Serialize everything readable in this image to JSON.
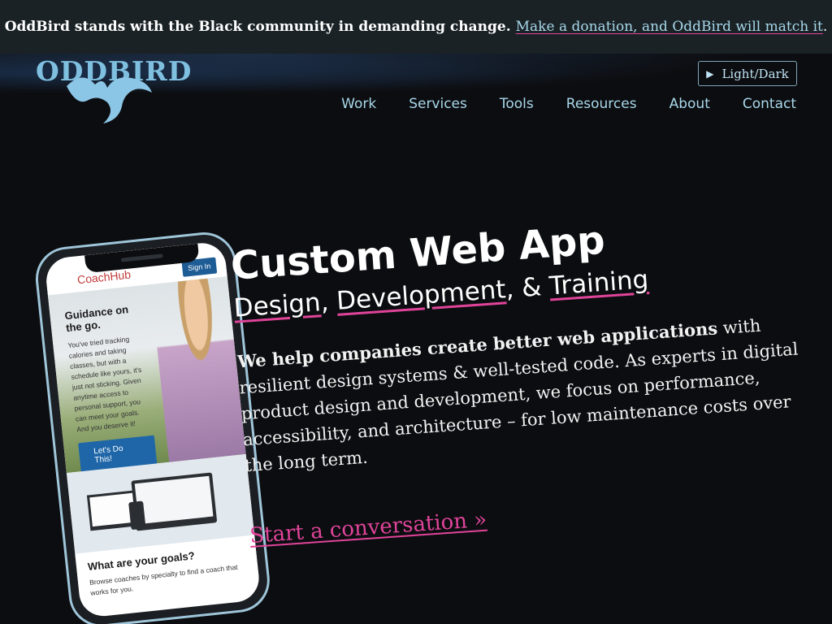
{
  "announcement": {
    "message": "OddBird stands with the Black community in demanding change.",
    "link": "Make a donation, and OddBird will match it",
    "trailing": "."
  },
  "logo": {
    "text": "ODDBIRD"
  },
  "theme_toggle": {
    "label": "Light/Dark"
  },
  "nav": {
    "items": [
      "Work",
      "Services",
      "Tools",
      "Resources",
      "About",
      "Contact"
    ]
  },
  "phone": {
    "brand": "CoachHub",
    "signin": "Sign In",
    "hero_title": "Guidance on the go.",
    "hero_body": "You've tried tracking calories and taking classes, but with a schedule like yours, it's just not sticking. Given anytime access to personal support, you can meet your goals. And you deserve it!",
    "hero_button": "Let's Do This!",
    "goals_title": "What are your goals?",
    "goals_body": "Browse coaches by specialty to find a coach that works for you."
  },
  "hero": {
    "title": "Custom Web App",
    "subtitle_parts": [
      "Design",
      ", ",
      "Development",
      ", & ",
      "Training"
    ],
    "intro_bold": "We help companies create better web applications",
    "intro_rest": " with resilient design systems & well-tested code. As experts in digital product design and development, we focus on performance, accessibility, and architecture – for low maintenance costs over the long term.",
    "cta": "Start a conversation »"
  },
  "colors": {
    "accent_pink": "#e0449a",
    "link_blue": "#a8d8ea",
    "background": "#0c0d10"
  }
}
